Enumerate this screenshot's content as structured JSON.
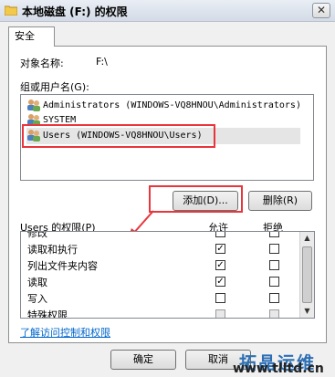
{
  "window": {
    "title": "本地磁盘 (F:) 的权限",
    "close_glyph": "✕"
  },
  "tab": {
    "label": "安全"
  },
  "object": {
    "label": "对象名称:",
    "value": "F:\\"
  },
  "groups": {
    "label": "组或用户名(G):",
    "items": [
      {
        "label": "Administrators (WINDOWS-VQ8HNOU\\Administrators)",
        "icon": "user-group-icon"
      },
      {
        "label": "SYSTEM",
        "icon": "user-group-icon"
      },
      {
        "label": "Users (WINDOWS-VQ8HNOU\\Users)",
        "icon": "user-group-icon"
      }
    ]
  },
  "buttons": {
    "add": "添加(D)...",
    "remove": "删除(R)",
    "ok": "确定",
    "cancel": "取消"
  },
  "permissions": {
    "label": "Users 的权限(P)",
    "allow_header": "允许",
    "deny_header": "拒绝",
    "rows": [
      {
        "name": "修改",
        "allow": false,
        "deny": false
      },
      {
        "name": "读取和执行",
        "allow": true,
        "deny": false
      },
      {
        "name": "列出文件夹内容",
        "allow": true,
        "deny": false
      },
      {
        "name": "读取",
        "allow": true,
        "deny": false
      },
      {
        "name": "写入",
        "allow": false,
        "deny": false
      },
      {
        "name": "特殊权限",
        "allow": false,
        "deny": false
      }
    ]
  },
  "link": {
    "label": "了解访问控制和权限"
  },
  "watermark": {
    "cn": "拓晶运维",
    "url": "www.tlltd.cn"
  },
  "colors": {
    "highlight": "#e8363c",
    "link": "#0066cc"
  }
}
